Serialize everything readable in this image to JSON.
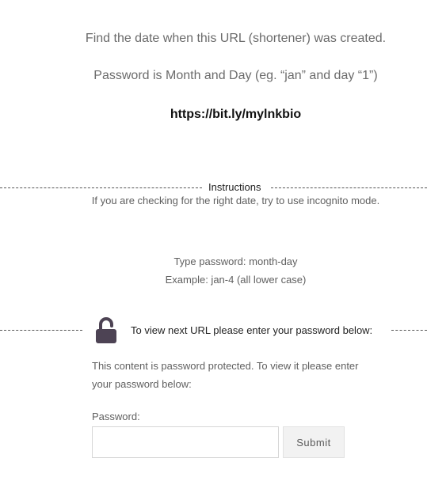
{
  "intro": {
    "line1": "Find the date when this URL (shortener) was created.",
    "line2": "Password is Month and Day (eg. “jan” and day “1”)",
    "url": "https://bit.ly/mylnkbio"
  },
  "instructions": {
    "heading": "Instructions",
    "text": "If you are checking for the right date, try to use incognito mode."
  },
  "password_hint": {
    "type_line": "Type password: month-day",
    "example_line": "Example: jan-4 (all lower case)"
  },
  "protected_form": {
    "heading": "To view next URL please enter your password below:",
    "lock_icon": "unlocked-padlock-icon",
    "lock_color": "#4d4354",
    "description": "This content is password protected. To view it please enter your password below:",
    "password_label": "Password:",
    "password_value": "",
    "submit_label": "Submit"
  }
}
